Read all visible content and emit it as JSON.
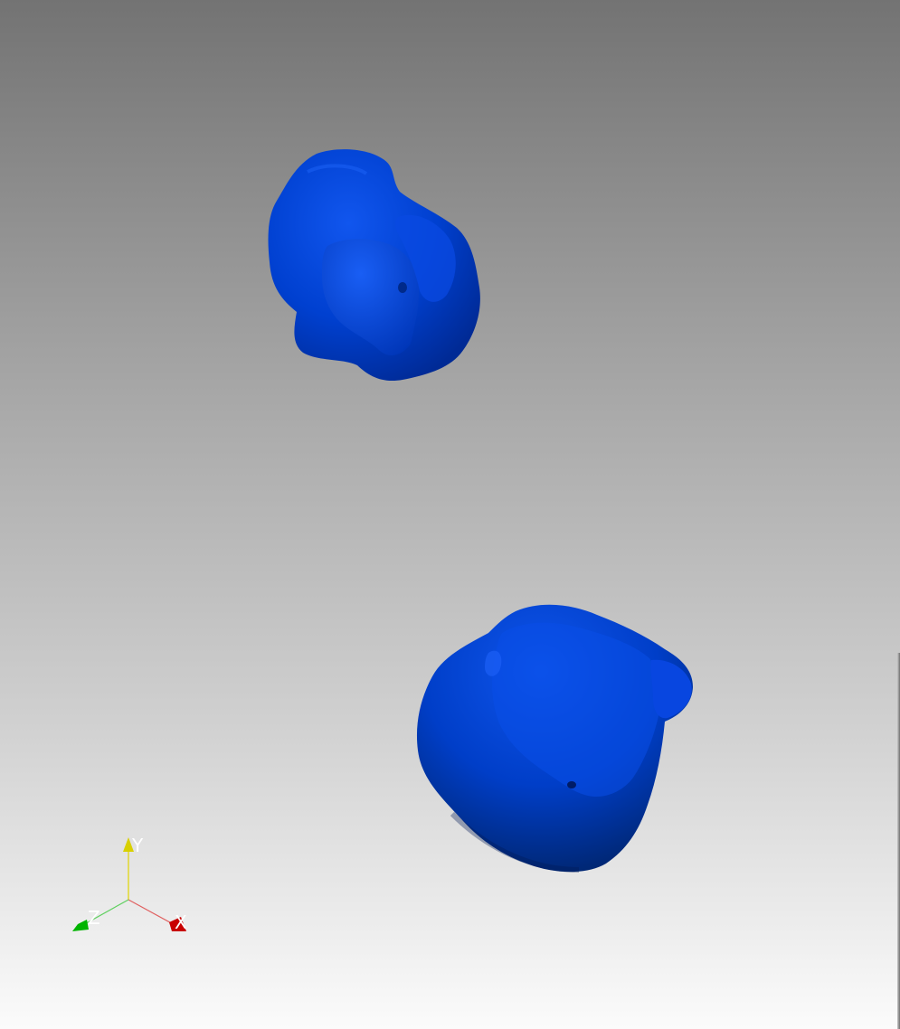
{
  "viewer": {
    "background_top": "#737373",
    "background_bottom": "#fbfbfb"
  },
  "objects": [
    {
      "name": "surface-blob-upper",
      "color": "#0039c8"
    },
    {
      "name": "surface-blob-lower",
      "color": "#0039c8"
    }
  ],
  "axes": {
    "x_label": "X",
    "y_label": "Y",
    "z_label": "Z",
    "x_color": "#e00000",
    "y_color": "#e0d400",
    "z_color": "#00c000"
  }
}
